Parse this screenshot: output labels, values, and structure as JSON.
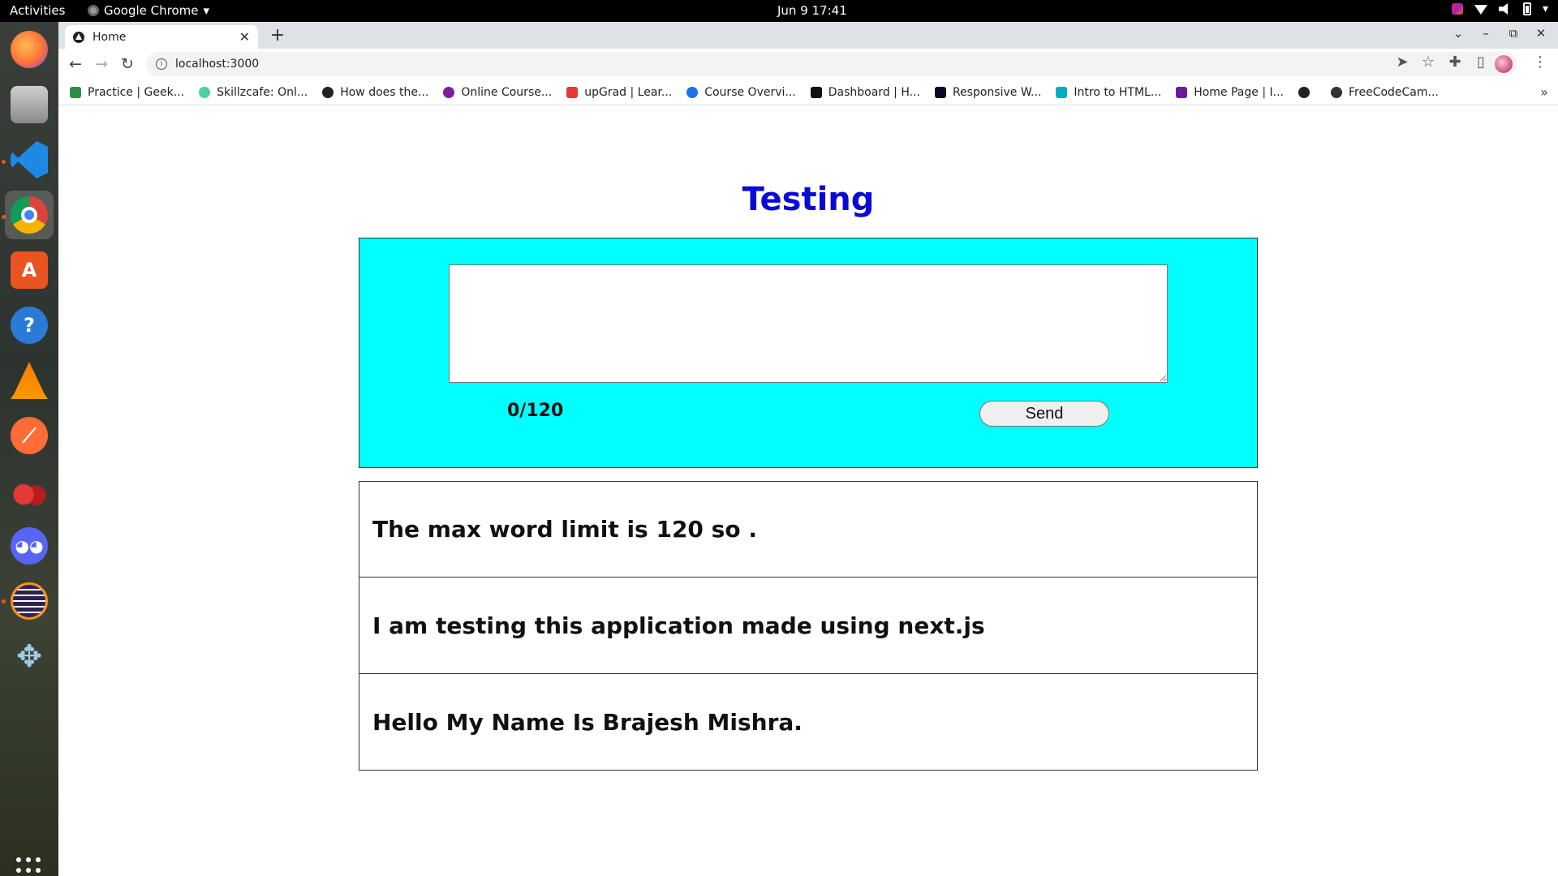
{
  "topbar": {
    "activities": "Activities",
    "app_name": "Google Chrome",
    "clock": "Jun 9  17:41"
  },
  "dock": {
    "items": [
      {
        "name": "firefox-icon",
        "color": "#ff7139"
      },
      {
        "name": "files-icon",
        "color": "#9e9e9e"
      },
      {
        "name": "vscode-icon",
        "color": "#1e88e5"
      },
      {
        "name": "chrome-icon",
        "color": "#4caf50"
      },
      {
        "name": "software-center-icon",
        "color": "#e95420"
      },
      {
        "name": "help-icon",
        "color": "#2a7bd6"
      },
      {
        "name": "vlc-icon",
        "color": "#f57c00"
      },
      {
        "name": "postman-icon",
        "color": "#ff6c37"
      },
      {
        "name": "cherry-icon",
        "color": "#c62828"
      },
      {
        "name": "discord-icon",
        "color": "#5865f2"
      },
      {
        "name": "eclipse-icon",
        "color": "#2c2255"
      },
      {
        "name": "ppsspp-icon",
        "color": "#7fb3d5"
      }
    ]
  },
  "browser": {
    "tab_title": "Home",
    "url": "localhost:3000",
    "bookmarks": [
      {
        "label": "Practice | Geek...",
        "color": "#2f8d46"
      },
      {
        "label": "Skillzcafe: Onl...",
        "color": "#4dd0a1"
      },
      {
        "label": "How does the...",
        "color": "#202124"
      },
      {
        "label": "Online Course...",
        "color": "#7b1fa2"
      },
      {
        "label": "upGrad | Lear...",
        "color": "#e53935"
      },
      {
        "label": "Course Overvi...",
        "color": "#1a73e8"
      },
      {
        "label": "Dashboard | H...",
        "color": "#111111"
      },
      {
        "label": "Responsive W...",
        "color": "#0a0a23"
      },
      {
        "label": "Intro to HTML...",
        "color": "#00acc1"
      },
      {
        "label": "Home Page | I...",
        "color": "#6a1b9a"
      },
      {
        "label": "",
        "color": "#202124"
      },
      {
        "label": "FreeCodeCam...",
        "color": "#333333"
      }
    ]
  },
  "page": {
    "title": "Testing",
    "title_color": "#0a0ad8",
    "composer_bg": "#00ffff",
    "textarea_value": "",
    "counter": "0/120",
    "send_label": "Send",
    "messages": [
      "The max word limit is 120 so .",
      "I am testing this application made using next.js",
      "Hello My Name Is Brajesh Mishra."
    ]
  }
}
